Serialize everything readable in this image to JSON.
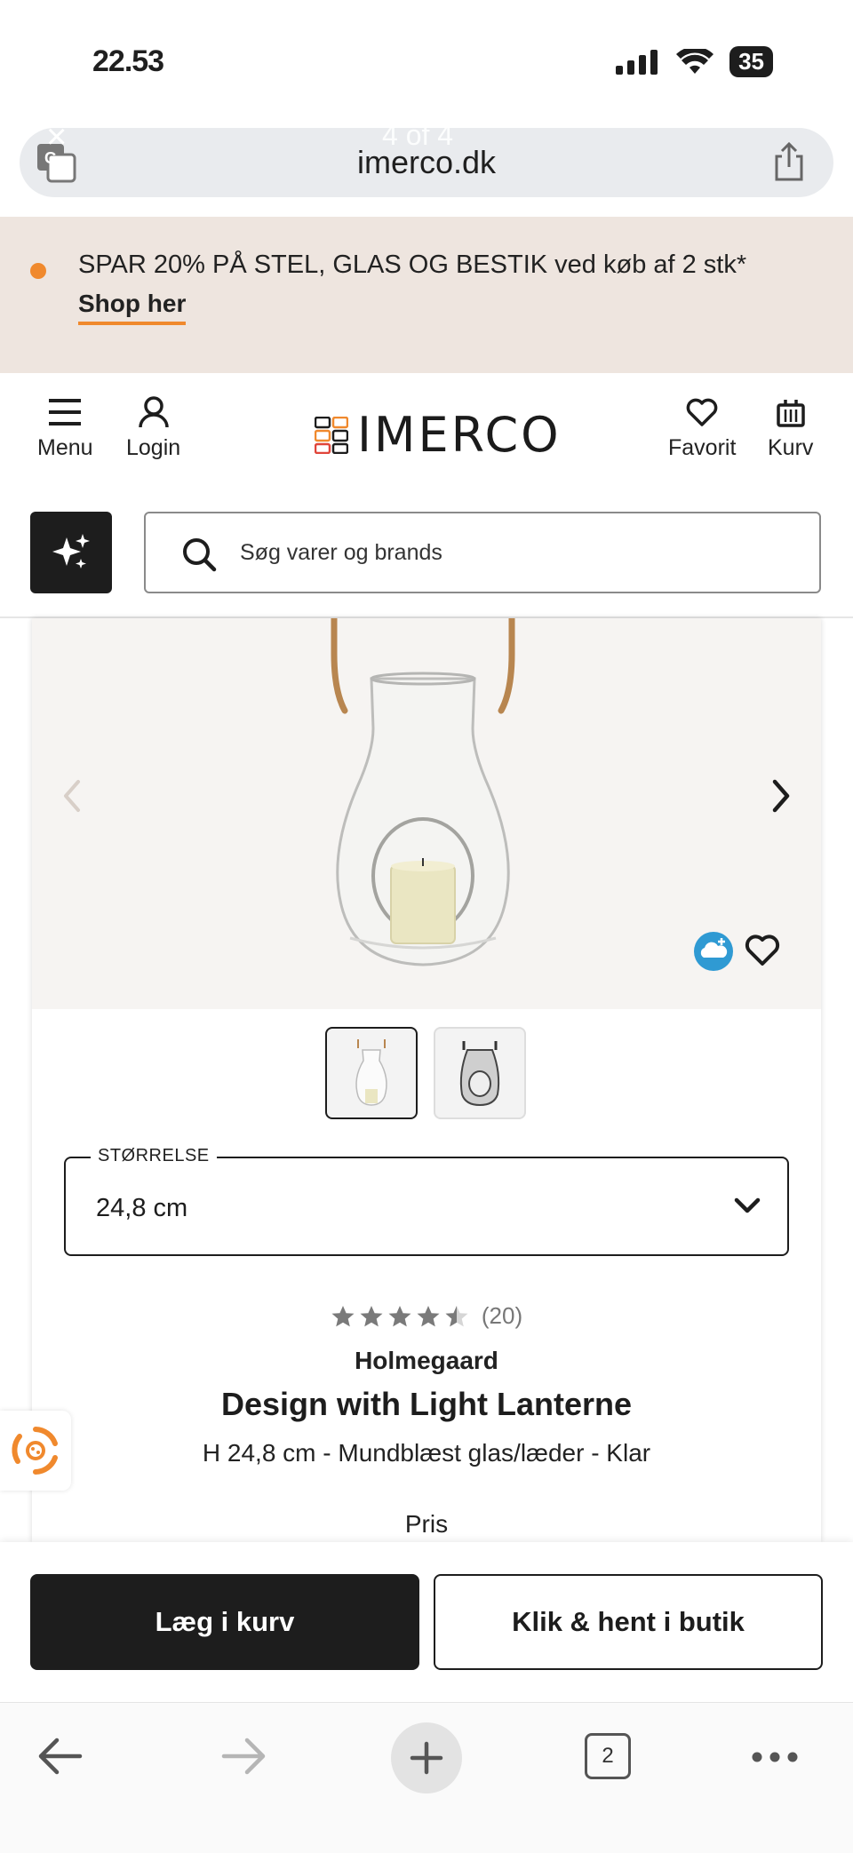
{
  "status": {
    "time": "22.53",
    "battery": "35"
  },
  "browser": {
    "url": "imerco.dk",
    "page_counter": "4 of 4",
    "close_symbol": "×"
  },
  "promo": {
    "text": "SPAR 20% PÅ STEL, GLAS OG BESTIK ved køb af 2 stk*",
    "link": "Shop her",
    "dot_color": "#f0892d"
  },
  "header": {
    "menu_label": "Menu",
    "login_label": "Login",
    "logo_text": "IMERCO",
    "favorite_label": "Favorit",
    "cart_label": "Kurv"
  },
  "search": {
    "placeholder": "Søg varer og brands"
  },
  "product": {
    "size_legend": "STØRRELSE",
    "size_value": "24,8 cm",
    "rating_stars": 4.5,
    "rating_count": "(20)",
    "brand": "Holmegaard",
    "title": "Design with Light Lanterne",
    "subtitle": "H 24,8 cm - Mundblæst glas/læder - Klar",
    "price_label": "Pris"
  },
  "actions": {
    "add_to_cart": "Læg i kurv",
    "click_collect": "Klik & hent i butik"
  },
  "toolbar": {
    "tabs_count": "2"
  },
  "colors": {
    "accent": "#f0892d",
    "dark": "#1d1d1d",
    "promo_bg": "#eee5df"
  }
}
